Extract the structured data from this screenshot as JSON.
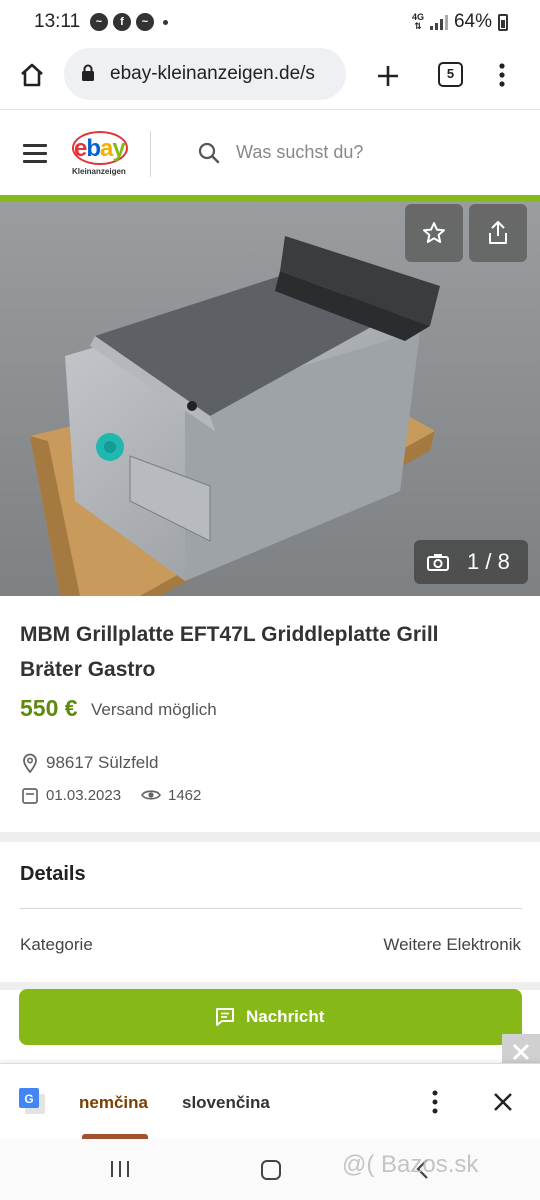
{
  "status_bar": {
    "time": "13:11",
    "network": "4G",
    "battery": "64%"
  },
  "browser": {
    "url": "ebay-kleinanzeigen.de/s",
    "tab_count": "5"
  },
  "site": {
    "logo_text": "ebay",
    "logo_subtext": "Kleinanzeigen",
    "search_placeholder": "Was suchst du?"
  },
  "gallery": {
    "counter": "1 / 8"
  },
  "ad": {
    "title": "MBM Grillplatte EFT47L Griddleplatte Grill Bräter Gastro",
    "price": "550 €",
    "shipping": "Versand möglich",
    "location": "98617 Sülzfeld",
    "date": "01.03.2023",
    "views": "1462"
  },
  "details": {
    "heading": "Details",
    "rows": [
      {
        "label": "Kategorie",
        "value": "Weitere Elektronik"
      }
    ]
  },
  "actions": {
    "message_button": "Nachricht"
  },
  "translate_bar": {
    "source_lang": "nemčina",
    "target_lang": "slovenčina"
  },
  "watermark": "@( Bazos.sk",
  "colors": {
    "brand_green": "#86b817",
    "price_green": "#5e8a10",
    "translate_accent": "#a0522d"
  }
}
